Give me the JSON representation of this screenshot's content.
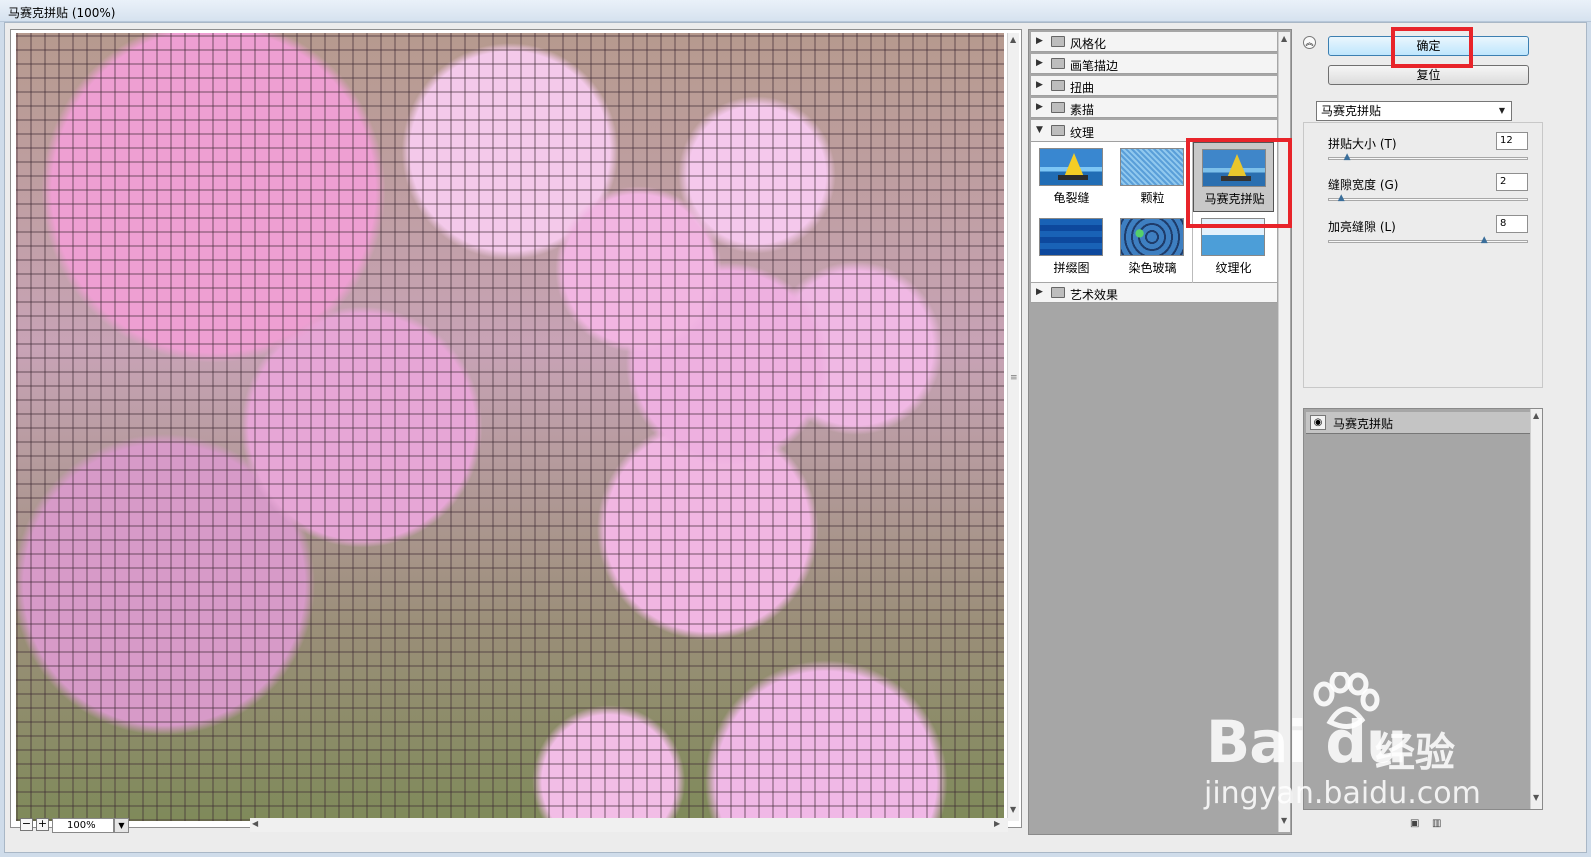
{
  "window": {
    "title": "马赛克拼贴 (100%)"
  },
  "preview": {
    "zoom": "100%",
    "zoom_out": "−",
    "zoom_in": "+"
  },
  "gallery": {
    "categories": [
      {
        "label": "风格化"
      },
      {
        "label": "画笔描边"
      },
      {
        "label": "扭曲"
      },
      {
        "label": "素描"
      },
      {
        "label": "纹理"
      },
      {
        "label": "艺术效果"
      }
    ],
    "texture_filters": [
      {
        "label": "龟裂缝"
      },
      {
        "label": "颗粒"
      },
      {
        "label": "马赛克拼贴"
      },
      {
        "label": "拼缀图"
      },
      {
        "label": "染色玻璃"
      },
      {
        "label": "纹理化"
      }
    ]
  },
  "buttons": {
    "ok": "确定",
    "reset": "复位"
  },
  "filter_select": {
    "value": "马赛克拼贴"
  },
  "params": [
    {
      "label": "拼贴大小 (T)",
      "value": "12",
      "slider_fraction": 0.1
    },
    {
      "label": "缝隙宽度 (G)",
      "value": "2",
      "slider_fraction": 0.07
    },
    {
      "label": "加亮缝隙 (L)",
      "value": "8",
      "slider_fraction": 0.8
    }
  ],
  "layers": {
    "items": [
      {
        "label": "马赛克拼贴"
      }
    ]
  },
  "watermark": {
    "brand": "Bai du",
    "brand_cn": "经验",
    "url": "jingyan.baidu.com"
  },
  "colors": {
    "highlight": "#e8242a",
    "ok_button": "#bee6fd"
  }
}
